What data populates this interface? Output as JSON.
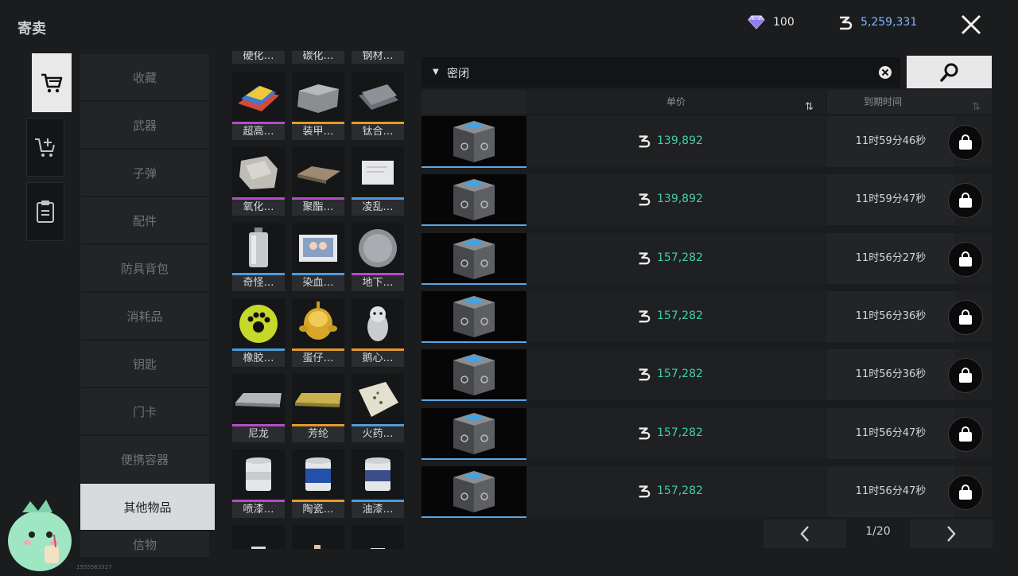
{
  "header": {
    "title": "寄卖",
    "gems": "100",
    "coins": "5,259,331"
  },
  "categories": [
    "收藏",
    "武器",
    "子弹",
    "配件",
    "防具背包",
    "消耗品",
    "钥匙",
    "门卡",
    "便携容器",
    "其他物品",
    "信物"
  ],
  "grid": {
    "top_labels": [
      "硬化…",
      "碳化…",
      "钢材…"
    ],
    "items": [
      {
        "label": "超高…",
        "rarity": "#b44cc8"
      },
      {
        "label": "装甲…",
        "rarity": "#e39a2a"
      },
      {
        "label": "钛合…",
        "rarity": "#e39a2a"
      },
      {
        "label": "氧化…",
        "rarity": "#b44cc8"
      },
      {
        "label": "聚酯…",
        "rarity": "#b44cc8"
      },
      {
        "label": "凌乱…",
        "rarity": "#4f9bd9"
      },
      {
        "label": "奇怪…",
        "rarity": "#4f9bd9"
      },
      {
        "label": "染血…",
        "rarity": "#4f9bd9"
      },
      {
        "label": "地下…",
        "rarity": "#b44cc8"
      },
      {
        "label": "橡胶…",
        "rarity": "#4f9bd9"
      },
      {
        "label": "蛋仔…",
        "rarity": "#e39a2a"
      },
      {
        "label": "鹅心…",
        "rarity": "#e39a2a"
      },
      {
        "label": "尼龙",
        "rarity": "#b44cc8"
      },
      {
        "label": "芳纶",
        "rarity": "#e39a2a"
      },
      {
        "label": "火药…",
        "rarity": "#4f9bd9"
      },
      {
        "label": "喷漆…",
        "rarity": "#b44cc8"
      },
      {
        "label": "陶瓷…",
        "rarity": "#e39a2a"
      },
      {
        "label": "油漆…",
        "rarity": "#4f9bd9"
      }
    ]
  },
  "search": {
    "value": "密闭"
  },
  "table": {
    "col_price": "单价",
    "col_expire": "到期时间",
    "rows": [
      {
        "price": "139,892",
        "time": "11时59分46秒"
      },
      {
        "price": "139,892",
        "time": "11时59分47秒"
      },
      {
        "price": "157,282",
        "time": "11时56分27秒"
      },
      {
        "price": "157,282",
        "time": "11时56分36秒"
      },
      {
        "price": "157,282",
        "time": "11时56分36秒"
      },
      {
        "price": "157,282",
        "time": "11时56分47秒"
      },
      {
        "price": "157,282",
        "time": "11时56分47秒"
      }
    ]
  },
  "pager": {
    "text": "1/20"
  },
  "footer": {
    "uid": "1555563327"
  },
  "icons": {
    "gem": "diamond-icon",
    "coin": "coin-icon",
    "close": "close-icon",
    "tab_shop": "shopping-cart-icon",
    "tab_sell": "cart-plus-icon",
    "tab_orders": "clipboard-icon",
    "search": "magnifier-icon",
    "clear": "clear-circle-icon",
    "buy": "shopping-bag-icon"
  }
}
